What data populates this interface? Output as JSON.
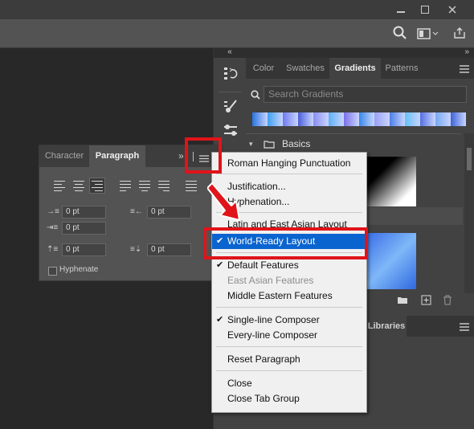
{
  "right_panel": {
    "tabs": [
      "Color",
      "Swatches",
      "Gradients",
      "Patterns"
    ],
    "search_placeholder": "Search Gradients",
    "group_label": "Basics",
    "lower_tab": "Libraries",
    "swatch_colors": [
      "#2a74e0",
      "#3ea0f0",
      "#6f7af0",
      "#4b5fd8",
      "#8a8ef0",
      "#5fb0f8",
      "#7b6fe8",
      "#3a88e8",
      "#9aa0f4",
      "#4c7ee6",
      "#63c0f8",
      "#5570e0",
      "#78a8f0",
      "#3d64d8"
    ]
  },
  "panel": {
    "tabs": [
      "Character",
      "Paragraph"
    ],
    "close": "»",
    "fields": [
      "0 pt",
      "0 pt",
      "0 pt",
      "0 pt",
      "0 pt"
    ],
    "hyphenate_label": "Hyphenate"
  },
  "menu": {
    "items": [
      {
        "label": "Roman Hanging Punctuation",
        "checked": false
      },
      {
        "label": "Justification...",
        "checked": false
      },
      {
        "label": "Hyphenation...",
        "checked": false
      },
      {
        "label": "Latin and East Asian Layout",
        "checked": false
      },
      {
        "label": "World-Ready Layout",
        "checked": true,
        "selected": true
      },
      {
        "label": "Default Features",
        "checked": true
      },
      {
        "label": "East Asian Features",
        "checked": false,
        "disabled": true
      },
      {
        "label": "Middle Eastern Features",
        "checked": false
      },
      {
        "label": "Single-line Composer",
        "checked": true
      },
      {
        "label": "Every-line Composer",
        "checked": false
      },
      {
        "label": "Reset Paragraph",
        "checked": false
      },
      {
        "label": "Close",
        "checked": false
      },
      {
        "label": "Close Tab Group",
        "checked": false
      }
    ]
  },
  "annotation_color": "#e0141a",
  "check_glyph": "✔"
}
